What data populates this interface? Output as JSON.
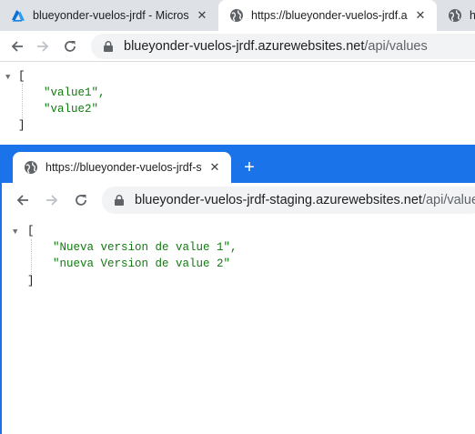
{
  "window1": {
    "tabs": [
      {
        "title": "blueyonder-vuelos-jrdf - Microsoft Azure",
        "favicon": "azure-icon",
        "active": false
      },
      {
        "title": "https://blueyonder-vuelos-jrdf.azurewebsites.net/api/values",
        "favicon": "globe-icon",
        "active": true
      },
      {
        "title": "h",
        "favicon": "globe-icon",
        "active": false
      }
    ],
    "close_glyph": "✕",
    "address": {
      "host": "blueyonder-vuelos-jrdf.azurewebsites.net",
      "path": "/api/values"
    },
    "json": {
      "open": "[",
      "items": [
        "\"value1\",",
        "\"value2\""
      ],
      "close": "]"
    }
  },
  "window2": {
    "tabs": [
      {
        "title": "https://blueyonder-vuelos-jrdf-staging.azurewebsites.net/api/values",
        "favicon": "globe-icon",
        "active": true
      }
    ],
    "close_glyph": "✕",
    "new_tab_glyph": "+",
    "address": {
      "host": "blueyonder-vuelos-jrdf-staging.azurewebsites.net",
      "path": "/api/values"
    },
    "json": {
      "open": "[",
      "items": [
        "\"Nueva version de value 1\",",
        "\"nueva Version de value 2\""
      ],
      "close": "]"
    }
  },
  "colors": {
    "accent": "#1a73e8",
    "json_string": "#0f7b0f",
    "tabstrip_inactive": "#dee1e6",
    "omnibox_bg": "#f1f3f4"
  }
}
